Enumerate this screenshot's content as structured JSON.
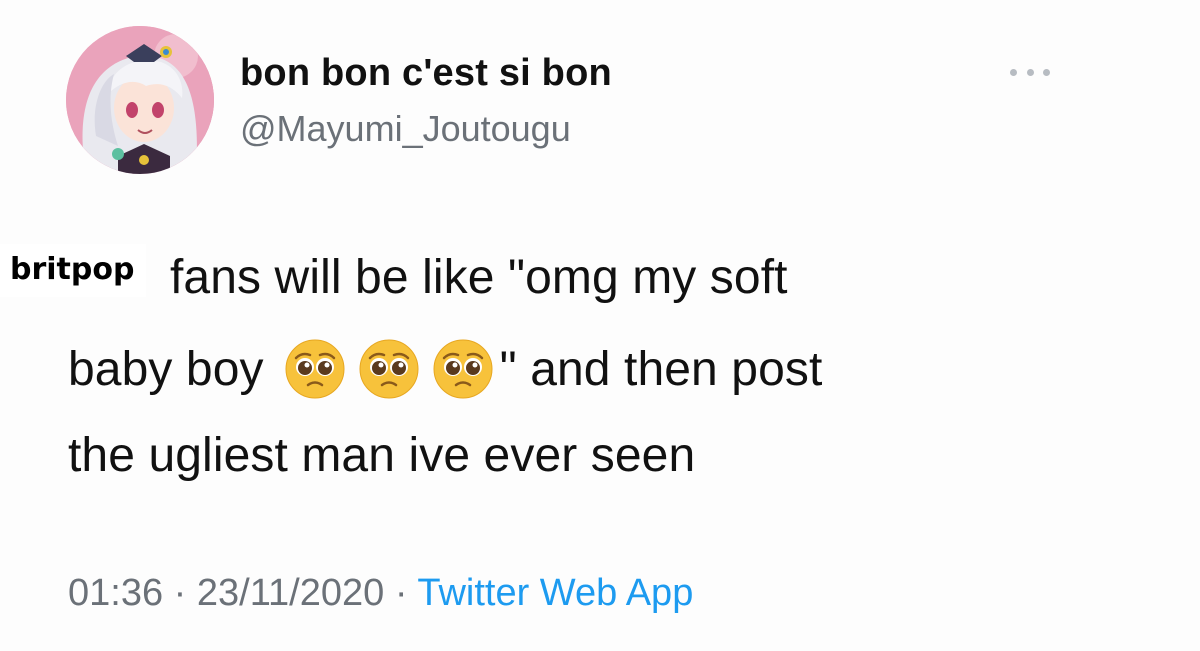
{
  "user": {
    "display_name": "bon bon c'est si bon",
    "handle": "@Mayumi_Joutougu",
    "avatar": "anime-character-avatar"
  },
  "overlay_label": "britpop",
  "tweet": {
    "line1": "fans will be like \"omg my soft",
    "line2_before": "baby boy",
    "line2_after": "\" and then post",
    "line3": "the ugliest man ive ever seen",
    "emojis": [
      "pleading-face-emoji",
      "pleading-face-emoji",
      "pleading-face-emoji"
    ]
  },
  "meta": {
    "time": "01:36",
    "sep1": "·",
    "date": "23/11/2020",
    "sep2": "·",
    "app": "Twitter Web App"
  },
  "colors": {
    "link": "#1d9bf0",
    "muted": "#6b7178",
    "text": "#111111"
  },
  "icons": {
    "more": "more-options-icon"
  }
}
